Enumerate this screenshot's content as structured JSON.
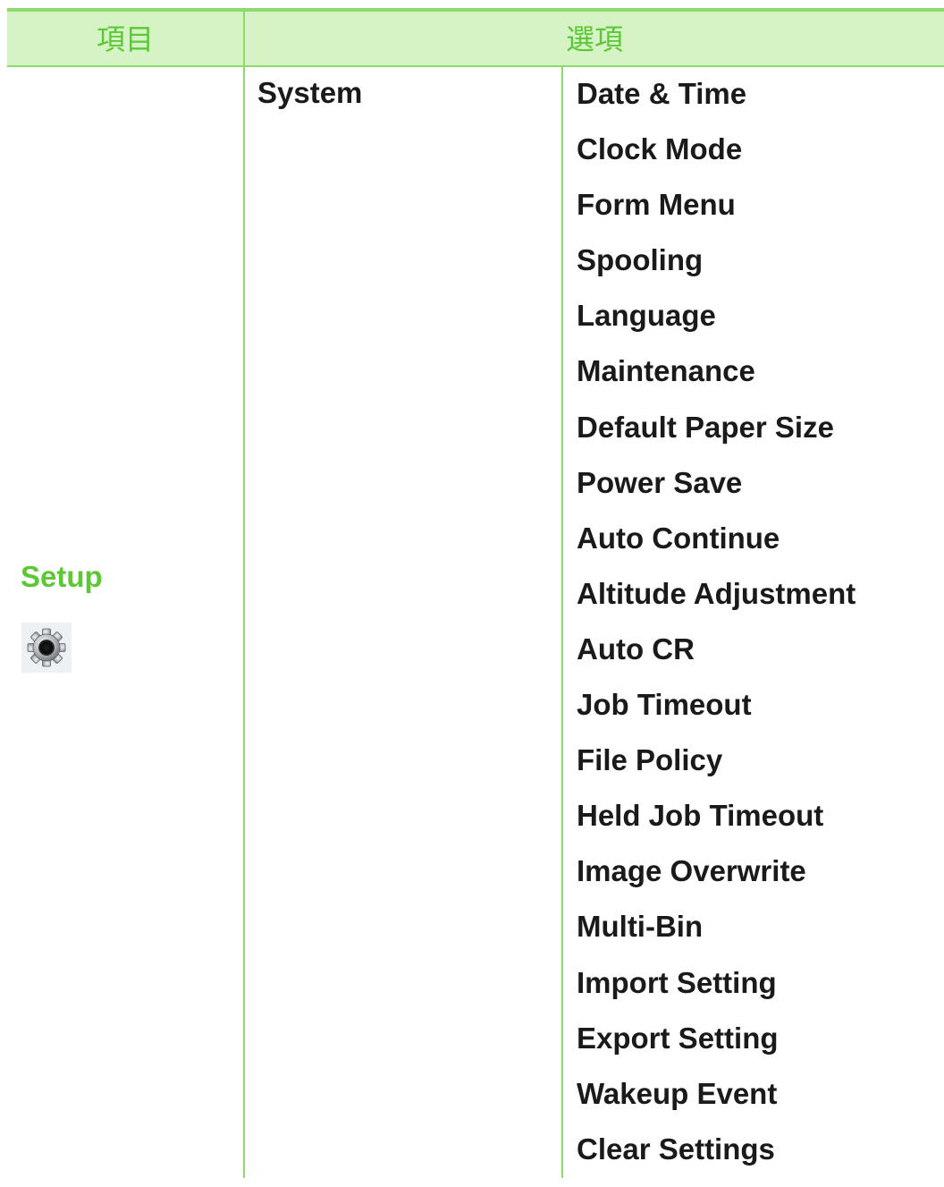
{
  "header": {
    "item_label": "項目",
    "option_label": "選項"
  },
  "category": {
    "label": "Setup",
    "icon": "gear-icon"
  },
  "submenu": {
    "label": "System"
  },
  "options": [
    "Date & Time",
    "Clock Mode",
    "Form Menu",
    "Spooling",
    "Language",
    "Maintenance",
    "Default Paper Size",
    "Power Save",
    "Auto Continue",
    "Altitude Adjustment",
    "Auto CR",
    "Job Timeout",
    "File Policy",
    "Held Job Timeout",
    "Image Overwrite",
    "Multi-Bin",
    "Import Setting",
    "Export Setting",
    "Wakeup Event",
    "Clear Settings"
  ],
  "colors": {
    "accent_green": "#5cc836",
    "rule_green": "#8dd96a",
    "header_background": "#d6f3c5",
    "body_text": "#1a1a1a"
  }
}
